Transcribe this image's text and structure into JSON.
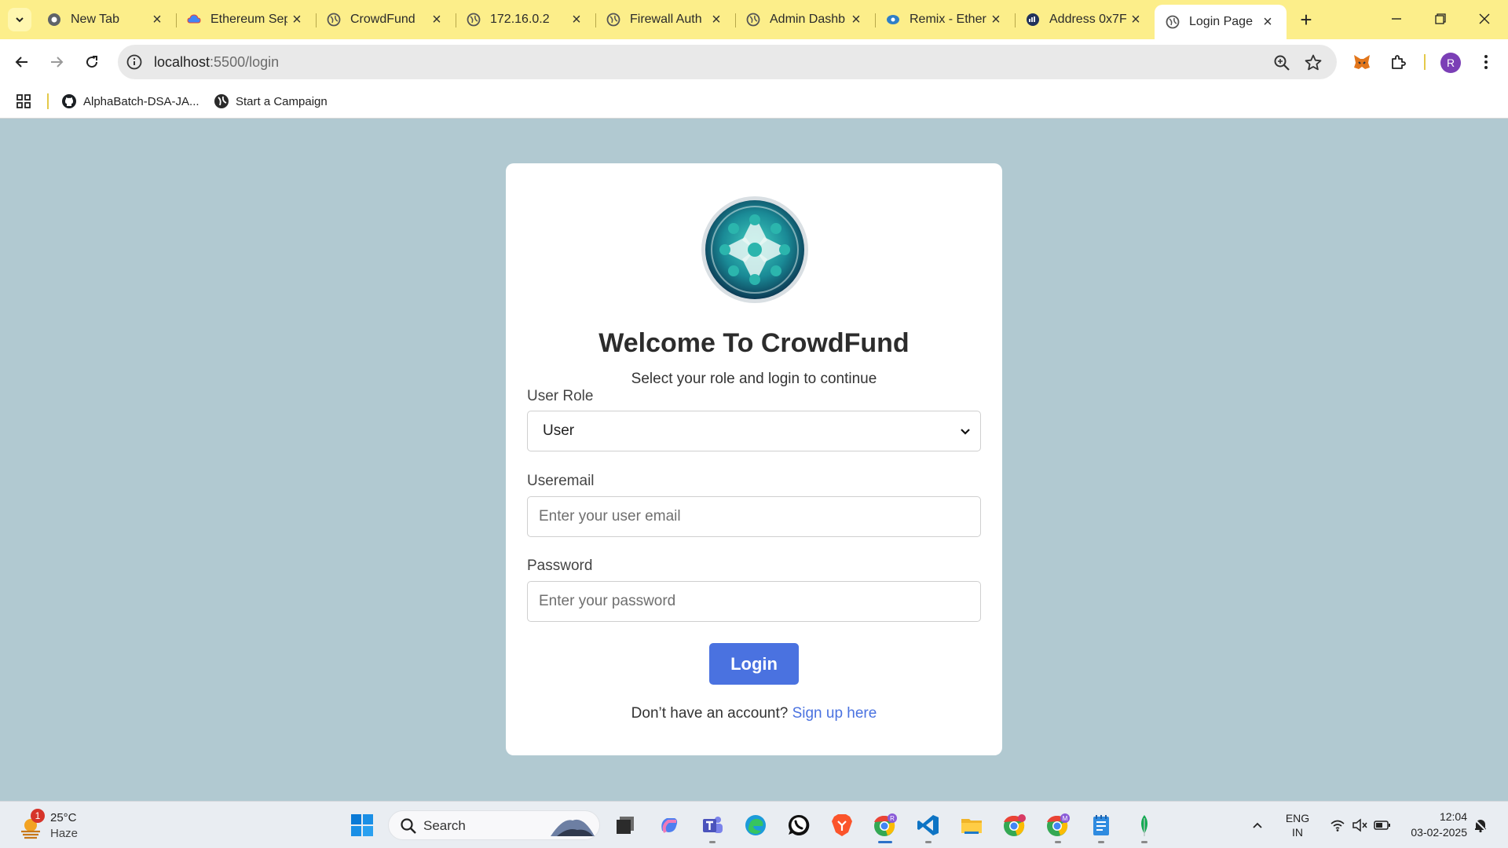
{
  "browser": {
    "tabs": [
      {
        "title": "New Tab",
        "icon": "chrome-icon"
      },
      {
        "title": "Ethereum Sep",
        "icon": "cloud-icon"
      },
      {
        "title": "CrowdFund",
        "icon": "globe-icon"
      },
      {
        "title": "172.16.0.2",
        "icon": "globe-icon"
      },
      {
        "title": "Firewall Auth",
        "icon": "globe-icon"
      },
      {
        "title": "Admin Dashb",
        "icon": "globe-icon"
      },
      {
        "title": "Remix - Ether",
        "icon": "remix-icon"
      },
      {
        "title": "Address 0x7F",
        "icon": "etherscan-icon"
      },
      {
        "title": "Login Page",
        "icon": "globe-icon",
        "active": true
      }
    ],
    "url": {
      "host": "localhost",
      "rest": ":5500/login"
    },
    "profile_initial": "R",
    "bookmarks": [
      {
        "label": "AlphaBatch-DSA-JA...",
        "icon": "github-icon"
      },
      {
        "label": "Start a Campaign",
        "icon": "globe-icon"
      }
    ]
  },
  "page": {
    "welcome_title": "Welcome To CrowdFund",
    "subtitle": "Select your role and login to continue",
    "role_label": "User Role",
    "role_selected": "User",
    "email_label": "Useremail",
    "email_placeholder": "Enter your user email",
    "password_label": "Password",
    "password_placeholder": "Enter your password",
    "login_button": "Login",
    "signup_prompt": "Don’t have an account?",
    "signup_link": "Sign up here"
  },
  "taskbar": {
    "weather": {
      "temp": "25°C",
      "condition": "Haze",
      "alert_count": "1"
    },
    "search_label": "Search",
    "language": {
      "line1": "ENG",
      "line2": "IN"
    },
    "time": "12:04",
    "date": "03-02-2025"
  },
  "colors": {
    "tabstrip": "#fcee8a",
    "page_bg": "#b1c9d1",
    "primary": "#4a72e0"
  }
}
